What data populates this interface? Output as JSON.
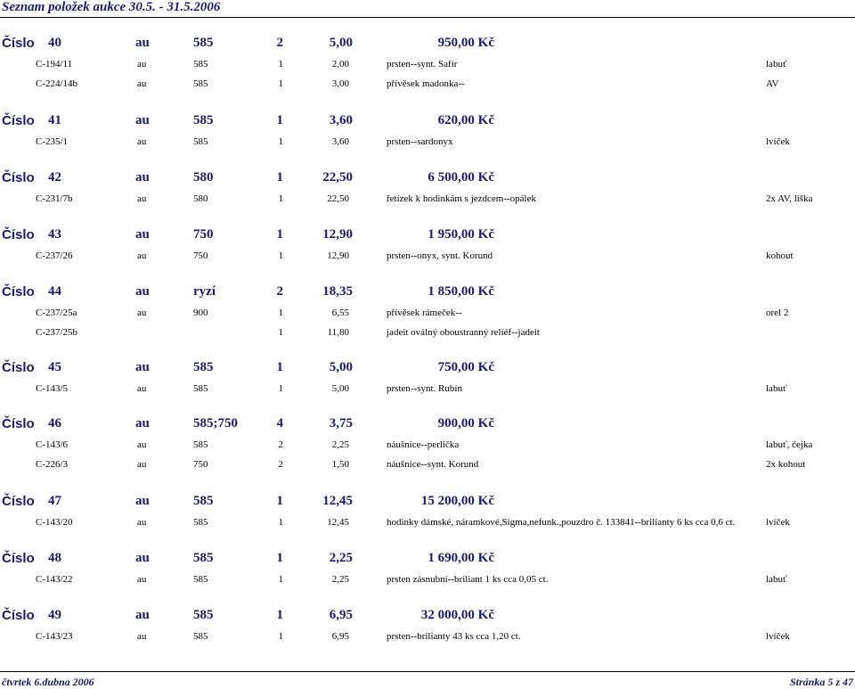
{
  "header": {
    "title": "Seznam položek aukce 30.5. - 31.5.2006"
  },
  "footer": {
    "date": "čtvrtek 6.dubna 2006",
    "page": "Stránka 5 z 47"
  },
  "groups": [
    {
      "label": "Číslo",
      "num": "40",
      "metal": "au",
      "purity": "585",
      "count": "2",
      "weight": "5,00",
      "price": "950,00 Kč",
      "items": [
        {
          "code": "C-194/11",
          "metal": "au",
          "purity": "585",
          "count": "1",
          "weight": "2,00",
          "desc": "prsten--synt. Safír",
          "mark": "labuť"
        },
        {
          "code": "C-224/14b",
          "metal": "au",
          "purity": "585",
          "count": "1",
          "weight": "3,00",
          "desc": "přívěsek madonka--",
          "mark": "AV"
        }
      ]
    },
    {
      "label": "Číslo",
      "num": "41",
      "metal": "au",
      "purity": "585",
      "count": "1",
      "weight": "3,60",
      "price": "620,00 Kč",
      "items": [
        {
          "code": "C-235/1",
          "metal": "au",
          "purity": "585",
          "count": "1",
          "weight": "3,60",
          "desc": "prsten--sardonyx",
          "mark": "lvíček"
        }
      ]
    },
    {
      "label": "Číslo",
      "num": "42",
      "metal": "au",
      "purity": "580",
      "count": "1",
      "weight": "22,50",
      "price": "6 500,00 Kč",
      "items": [
        {
          "code": "C-231/7b",
          "metal": "au",
          "purity": "580",
          "count": "1",
          "weight": "22,50",
          "desc": "řetízek k hodinkám s jezdcem--opálek",
          "mark": "2x AV, liška"
        }
      ]
    },
    {
      "label": "Číslo",
      "num": "43",
      "metal": "au",
      "purity": "750",
      "count": "1",
      "weight": "12,90",
      "price": "1 950,00 Kč",
      "items": [
        {
          "code": "C-237/26",
          "metal": "au",
          "purity": "750",
          "count": "1",
          "weight": "12,90",
          "desc": "prsten--onyx, synt. Korund",
          "mark": "kohout"
        }
      ]
    },
    {
      "label": "Číslo",
      "num": "44",
      "metal": "au",
      "purity": "ryzí",
      "count": "2",
      "weight": "18,35",
      "price": "1 850,00 Kč",
      "items": [
        {
          "code": "C-237/25a",
          "metal": "au",
          "purity": "900",
          "count": "1",
          "weight": "6,55",
          "desc": "přívěsek rámeček--",
          "mark": "orel 2"
        },
        {
          "code": "C-237/25b",
          "metal": "",
          "purity": "",
          "count": "1",
          "weight": "11,80",
          "desc": "jadeit oválný oboustranný reliéf--jadeit",
          "mark": ""
        }
      ]
    },
    {
      "label": "Číslo",
      "num": "45",
      "metal": "au",
      "purity": "585",
      "count": "1",
      "weight": "5,00",
      "price": "750,00 Kč",
      "items": [
        {
          "code": "C-143/5",
          "metal": "au",
          "purity": "585",
          "count": "1",
          "weight": "5,00",
          "desc": "prsten--synt. Rubín",
          "mark": "labuť"
        }
      ]
    },
    {
      "label": "Číslo",
      "num": "46",
      "metal": "au",
      "purity": "585;750",
      "count": "4",
      "weight": "3,75",
      "price": "900,00 Kč",
      "items": [
        {
          "code": "C-143/6",
          "metal": "au",
          "purity": "585",
          "count": "2",
          "weight": "2,25",
          "desc": "náušnice--perlička",
          "mark": "labuť, čejka"
        },
        {
          "code": "C-226/3",
          "metal": "au",
          "purity": "750",
          "count": "2",
          "weight": "1,50",
          "desc": "náušnice--synt. Korund",
          "mark": "2x kohout"
        }
      ]
    },
    {
      "label": "Číslo",
      "num": "47",
      "metal": "au",
      "purity": "585",
      "count": "1",
      "weight": "12,45",
      "price": "15 200,00 Kč",
      "items": [
        {
          "code": "C-143/20",
          "metal": "au",
          "purity": "585",
          "count": "1",
          "weight": "12,45",
          "desc": "hodinky dámské, náramkové,Sigma,nefunk.,pouzdro č. 133841--brilianty 6 ks cca 0,6 ct.",
          "mark": "lvíček"
        }
      ]
    },
    {
      "label": "Číslo",
      "num": "48",
      "metal": "au",
      "purity": "585",
      "count": "1",
      "weight": "2,25",
      "price": "1 690,00 Kč",
      "items": [
        {
          "code": "C-143/22",
          "metal": "au",
          "purity": "585",
          "count": "1",
          "weight": "2,25",
          "desc": "prsten zásnubní--briliant 1 ks cca 0,05 ct.",
          "mark": "labuť"
        }
      ]
    },
    {
      "label": "Číslo",
      "num": "49",
      "metal": "au",
      "purity": "585",
      "count": "1",
      "weight": "6,95",
      "price": "32 000,00 Kč",
      "items": [
        {
          "code": "C-143/23",
          "metal": "au",
          "purity": "585",
          "count": "1",
          "weight": "6,95",
          "desc": "prsten--brilianty 43 ks cca 1,20 ct.",
          "mark": "lvíček"
        }
      ]
    }
  ]
}
